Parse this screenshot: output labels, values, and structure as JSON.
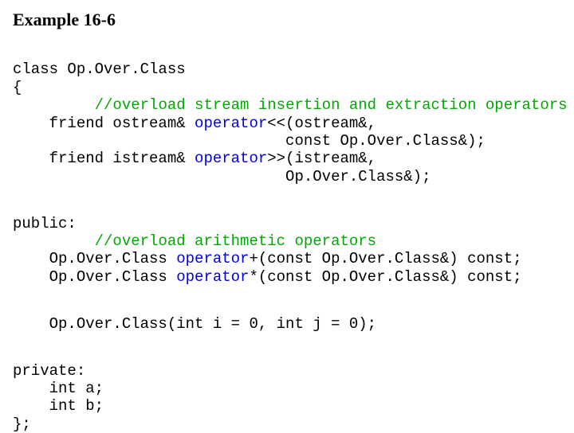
{
  "title": "Example 16-6",
  "code": {
    "l1": "class Op.Over.Class",
    "l2": "{",
    "l3_indent": "         ",
    "l3_comment": "//overload stream insertion and extraction operators",
    "l4a": "    friend ostream& ",
    "l4b": "operator",
    "l4c": "<<(ostream&,",
    "l5": "                              const Op.Over.Class&);",
    "l6a": "    friend istream& ",
    "l6b": "operator",
    "l6c": ">>(istream&,",
    "l7": "                              Op.Over.Class&);",
    "l8": "public:",
    "l9_indent": "         ",
    "l9_comment": "//overload arithmetic operators",
    "l10a": "    Op.Over.Class ",
    "l10b": "operator",
    "l10c": "+(const Op.Over.Class&) const;",
    "l11a": "    Op.Over.Class ",
    "l11b": "operator",
    "l11c": "*(const Op.Over.Class&) const;",
    "l12": "    Op.Over.Class(int i = 0, int j = 0);",
    "l13": "private:",
    "l14": "    int a;",
    "l15": "    int b;",
    "l16": "};"
  }
}
